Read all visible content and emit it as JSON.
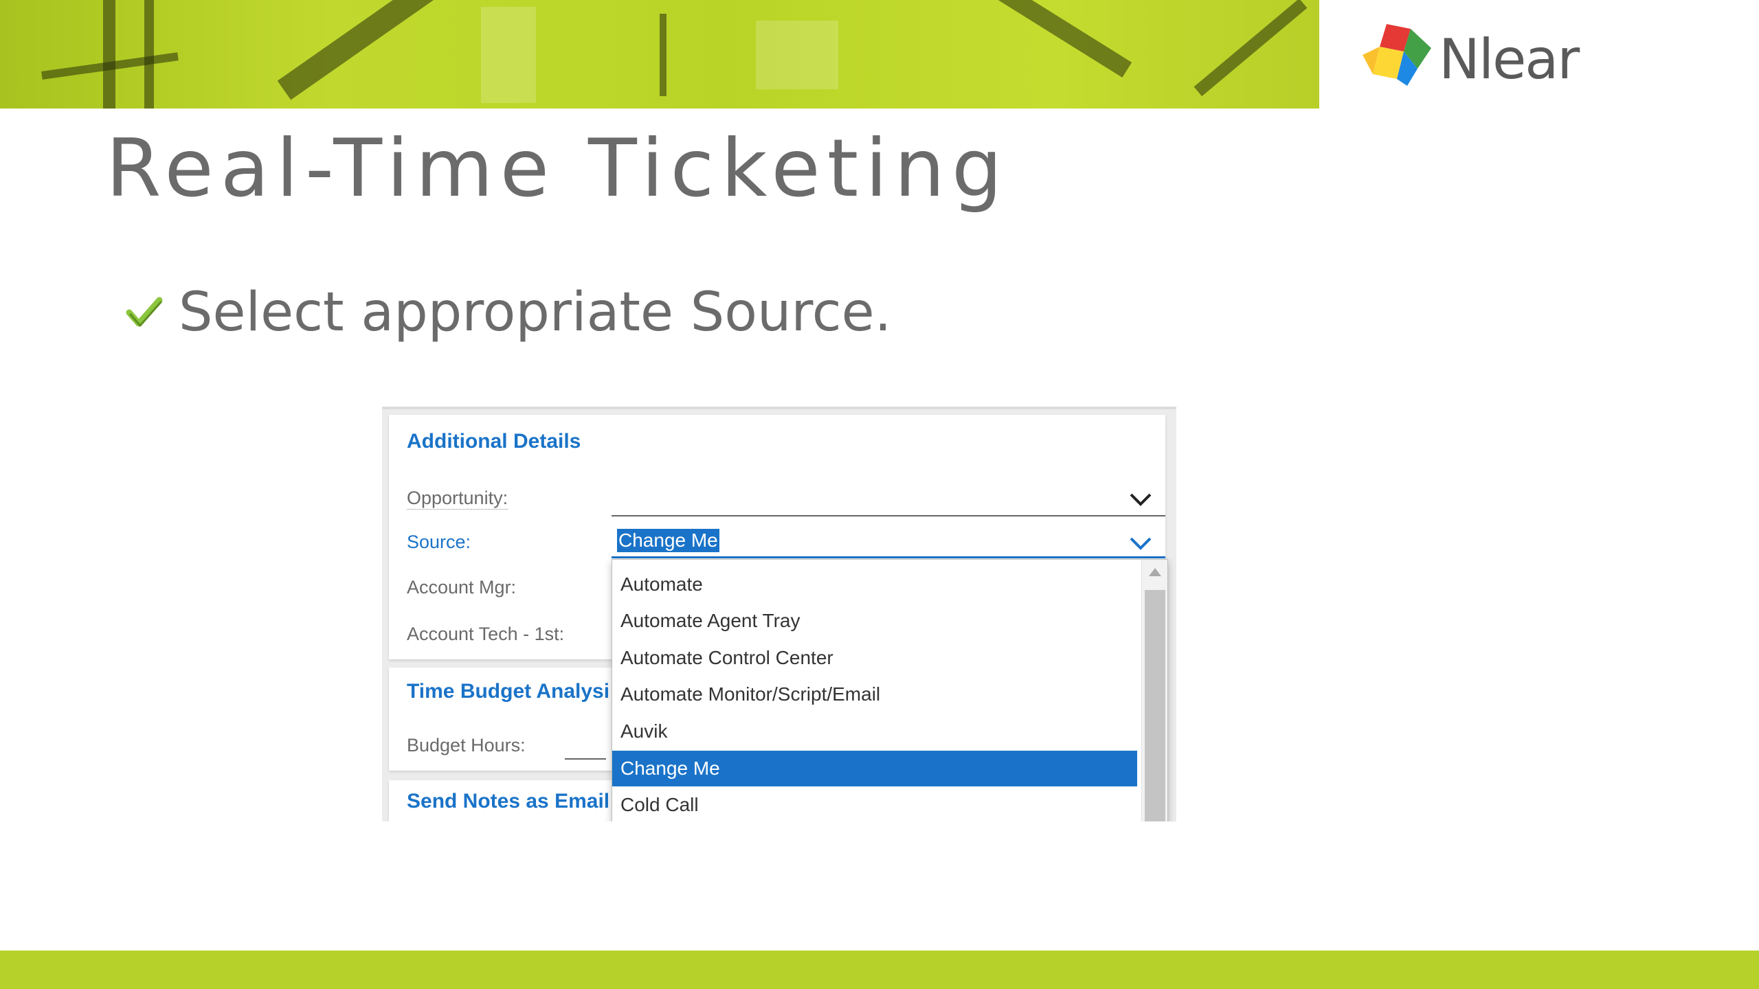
{
  "slide": {
    "title": "Real-Time Ticketing",
    "bullet": "Select appropriate Source."
  },
  "logo": {
    "text": "Nlear",
    "icon": "nlear-logo-icon"
  },
  "colors": {
    "banner": "#bcd62a",
    "accent_blue": "#1a73c8",
    "text_gray": "#6b6b6b",
    "check_green": "#8cc63f"
  },
  "form": {
    "additional_details": {
      "title": "Additional Details",
      "opportunity_label": "Opportunity:",
      "source_label": "Source:",
      "source_value": "Change Me",
      "account_mgr_label": "Account Mgr:",
      "account_tech_label": "Account Tech - 1st:"
    },
    "time_budget": {
      "title": "Time Budget Analysi",
      "budget_hours_label": "Budget Hours:"
    },
    "send_notes": {
      "title": "Send Notes as Email"
    }
  },
  "dropdown": {
    "options": [
      "Automate",
      "Automate Agent Tray",
      "Automate Control Center",
      "Automate Monitor/Script/Email",
      "Auvik",
      "Change Me",
      "Cold Call"
    ],
    "selected": "Change Me"
  }
}
